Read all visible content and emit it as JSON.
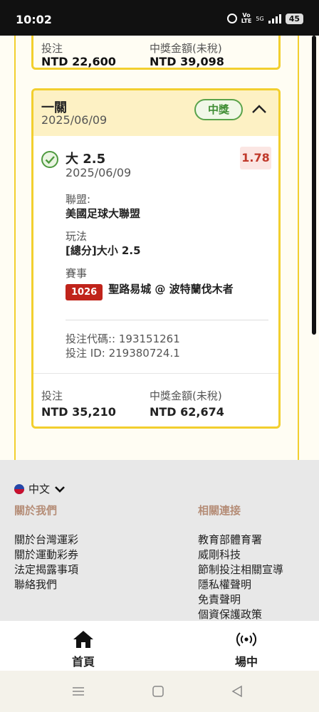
{
  "status_bar": {
    "time": "10:02",
    "volte": "Vo\nLTE",
    "network": "5G",
    "battery": "45"
  },
  "top_card": {
    "bet_label": "投注",
    "bet_amount": "NTD 22,600",
    "prize_label": "中獎金額(未稅)",
    "prize_amount": "NTD 39,098"
  },
  "bet_card": {
    "title": "一關",
    "date": "2025/06/09",
    "status_badge": "中獎",
    "selection": "大 2.5",
    "selection_date": "2025/06/09",
    "odds": "1.78",
    "league_label": "聯盟:",
    "league_value": "美國足球大聯盟",
    "market_label": "玩法",
    "market_value": "[總分]大小 2.5",
    "event_label": "賽事",
    "event_id": "1026",
    "event_name": "聖路易城 @ 波特蘭伐木者",
    "bet_code": "投注代碼:: 193151261",
    "bet_id": "投注 ID: 219380724.1",
    "bet_label": "投注",
    "bet_amount": "NTD 35,210",
    "prize_label": "中獎金額(未稅)",
    "prize_amount": "NTD 62,674"
  },
  "footer": {
    "language": "中文",
    "about_title": "關於我們",
    "about_links": [
      "關於台灣運彩",
      "關於運動彩券",
      "法定揭露事項",
      "聯絡我們"
    ],
    "related_title": "相關連接",
    "related_links": [
      "教育部體育署",
      "威剛科技",
      "節制投注相關宣導",
      "隱私權聲明",
      "免責聲明",
      "個資保護政策"
    ]
  },
  "bottom_nav": {
    "home": "首頁",
    "live": "場中"
  }
}
